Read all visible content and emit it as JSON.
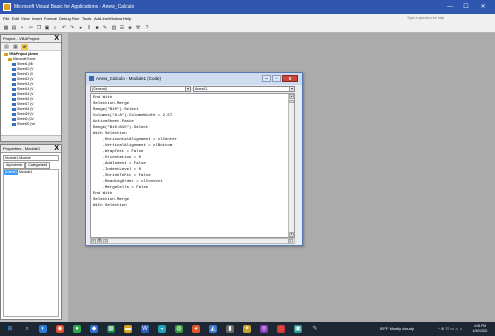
{
  "window": {
    "title": "Microsoft Visual Basic for Applications - Anew_Calculo",
    "min": "—",
    "max": "☐",
    "close": "✕"
  },
  "menu": {
    "items": [
      "File",
      "Edit",
      "View",
      "Insert",
      "Format",
      "Debug",
      "Run",
      "Tools",
      "Add-Ins",
      "Window",
      "Help"
    ],
    "help_box": "Type a question for help"
  },
  "project": {
    "title": "Project - VBAProject",
    "close": "X",
    "tree": [
      "VBAProject (Anew",
      "Microsoft Excel",
      "Sheet1 (Mi",
      "Sheet10 (V",
      "Sheet11 (V",
      "Sheet12 (V",
      "Sheet13 (V",
      "Sheet14 (V",
      "Sheet15 (V",
      "Sheet16 (V",
      "Sheet17 (V",
      "Sheet18 (V",
      "Sheet19 (V",
      "Sheet2 (Ov",
      "Sheet20 (Ve"
    ]
  },
  "properties": {
    "title": "Properties - Module1",
    "close": "X",
    "selector": "Module1 Module",
    "tabs": [
      "Alphabetic",
      "Categorized"
    ],
    "row_key": "(Name)",
    "row_value": "Module1"
  },
  "code_window": {
    "title": "Anew_Calculo - Module1 (Code)",
    "object_combo": "(General)",
    "proc_combo": "Anew11",
    "lines": [
      "End With",
      "Selection.Merge",
      "Range(\"B10\").Select",
      "Columns(\"A:A\").ColumnWidth = 2.57",
      "ActiveSheet.Paste",
      "Range(\"B10:B15\").Select",
      "With Selection",
      "    .HorizontalAlignment = xlCenter",
      "    .VerticalAlignment = xlBottom",
      "    .WrapText = False",
      "    .Orientation = 0",
      "    .AddIndent = False",
      "    .IndentLevel = 0",
      "    .ShrinkToFit = False",
      "    .ReadingOrder = xlContext",
      "    .MergeCells = False",
      "End With",
      "Selection.Merge",
      "With Selection"
    ]
  },
  "taskbar": {
    "weather": "59°F Mostly cloudy",
    "tray": "^ ⊕ ☷ ▭ ♫ ☼",
    "time": "4:06 PM",
    "date": "4/30/2022"
  },
  "colors": {
    "title_bar": "#2f57b0",
    "taskbar": "#1d2633",
    "mdi_background": "#ababab",
    "selection": "#3399ff"
  }
}
